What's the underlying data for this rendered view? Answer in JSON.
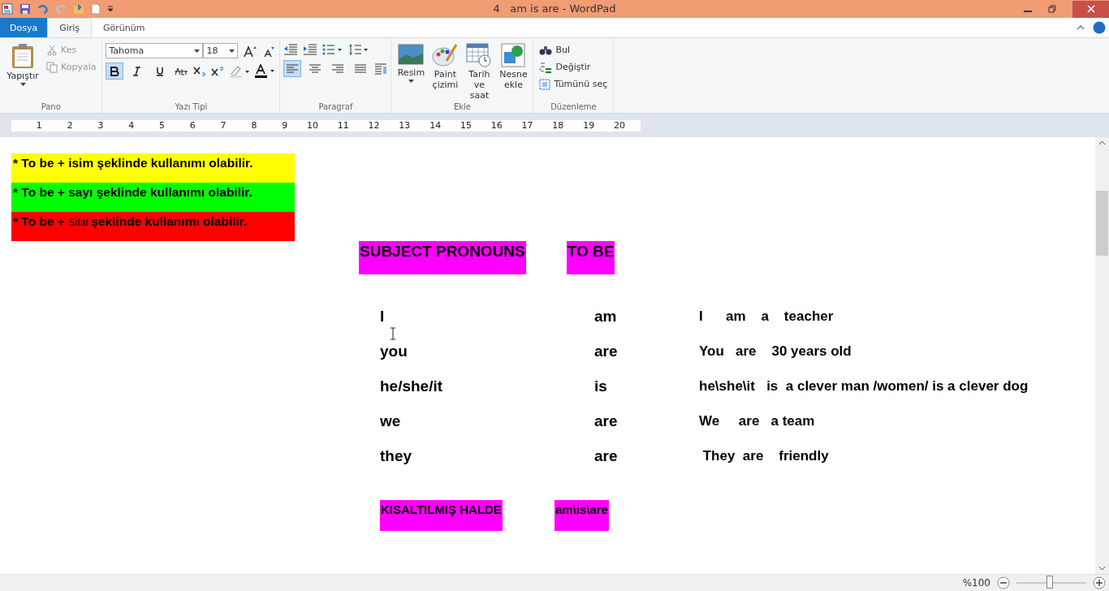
{
  "window": {
    "title": "4   am is are - WordPad"
  },
  "tabs": [
    {
      "label": "Dosya",
      "kind": "file",
      "selected": false
    },
    {
      "label": "Giriş",
      "kind": "tab",
      "selected": true
    },
    {
      "label": "Görünüm",
      "kind": "tab",
      "selected": false
    }
  ],
  "ribbon": {
    "clipboard": {
      "label": "Pano",
      "paste": "Yapıştır",
      "cut": {
        "label": "Kes",
        "disabled": true
      },
      "copy": {
        "label": "Kopyala",
        "disabled": true
      }
    },
    "font": {
      "label": "Yazı Tipi",
      "family": "Tahoma",
      "size": "18",
      "bold": true,
      "italic": false,
      "underline": false
    },
    "paragraph": {
      "label": "Paragraf",
      "align_buttons": [
        {
          "kind": "left",
          "selected": true
        },
        {
          "kind": "center",
          "selected": false
        },
        {
          "kind": "right",
          "selected": false
        },
        {
          "kind": "justify",
          "selected": false
        }
      ]
    },
    "insert": {
      "label": "Ekle",
      "items": [
        {
          "kind": "picture",
          "label": "Resim"
        },
        {
          "kind": "paint",
          "label": "Paint çizimi"
        },
        {
          "kind": "datetime",
          "label": "Tarih ve saat"
        },
        {
          "kind": "object",
          "label": "Nesne ekle"
        }
      ]
    },
    "editing": {
      "label": "Düzenleme",
      "items": [
        {
          "kind": "find",
          "label": "Bul"
        },
        {
          "kind": "replace",
          "label": "Değiştir"
        },
        {
          "kind": "selectall",
          "label": "Tümünü seç"
        }
      ]
    }
  },
  "ruler": [
    "1",
    "2",
    "3",
    "4",
    "5",
    "6",
    "7",
    "8",
    "9",
    "10",
    "11",
    "12",
    "13",
    "14",
    "15",
    "16",
    "17",
    "18",
    "19",
    "20"
  ],
  "document": {
    "highlights": [
      {
        "color": "#ffff00",
        "parts": [
          {
            "text": "* To be + isim şeklinde kullanımı olabilir.",
            "kind": "normal"
          }
        ]
      },
      {
        "color": "#00ff00",
        "parts": [
          {
            "text": "* To be + sayı şeklinde kullanımı olabilir.",
            "kind": "normal"
          }
        ]
      },
      {
        "color": "#ff0000",
        "parts": [
          {
            "text": "* To be + ",
            "kind": "normal"
          },
          {
            "text": "Sıfat ",
            "kind": "small"
          },
          {
            "text": " şeklinde kullanımı olabilir.",
            "kind": "normal"
          }
        ]
      }
    ],
    "headings": [
      {
        "text": "SUBJECT PRONOUNS",
        "color": "#ff00ff"
      },
      {
        "text": "TO BE",
        "color": "#ff00ff"
      }
    ],
    "rows": [
      {
        "pronoun": "I",
        "verb": "am",
        "example": "I      am    a    teacher"
      },
      {
        "pronoun": "you",
        "verb": "are",
        "example": "You   are    30 years old"
      },
      {
        "pronoun": "he/she/it",
        "verb": "is",
        "example": "he\\she\\it   is  a clever man /women/ is a clever dog"
      },
      {
        "pronoun": "we",
        "verb": "are",
        "example": "We     are   a team"
      },
      {
        "pronoun": "they",
        "verb": "are",
        "example": " They  are    friendly"
      }
    ],
    "footer": [
      {
        "text": "KISALTILMIŞ HALDE",
        "color": "#ff00ff"
      },
      {
        "text": "am\\is\\are",
        "color": "#ff00ff"
      }
    ]
  },
  "status_bar": {
    "zoom": "%100",
    "level": 0.48
  }
}
